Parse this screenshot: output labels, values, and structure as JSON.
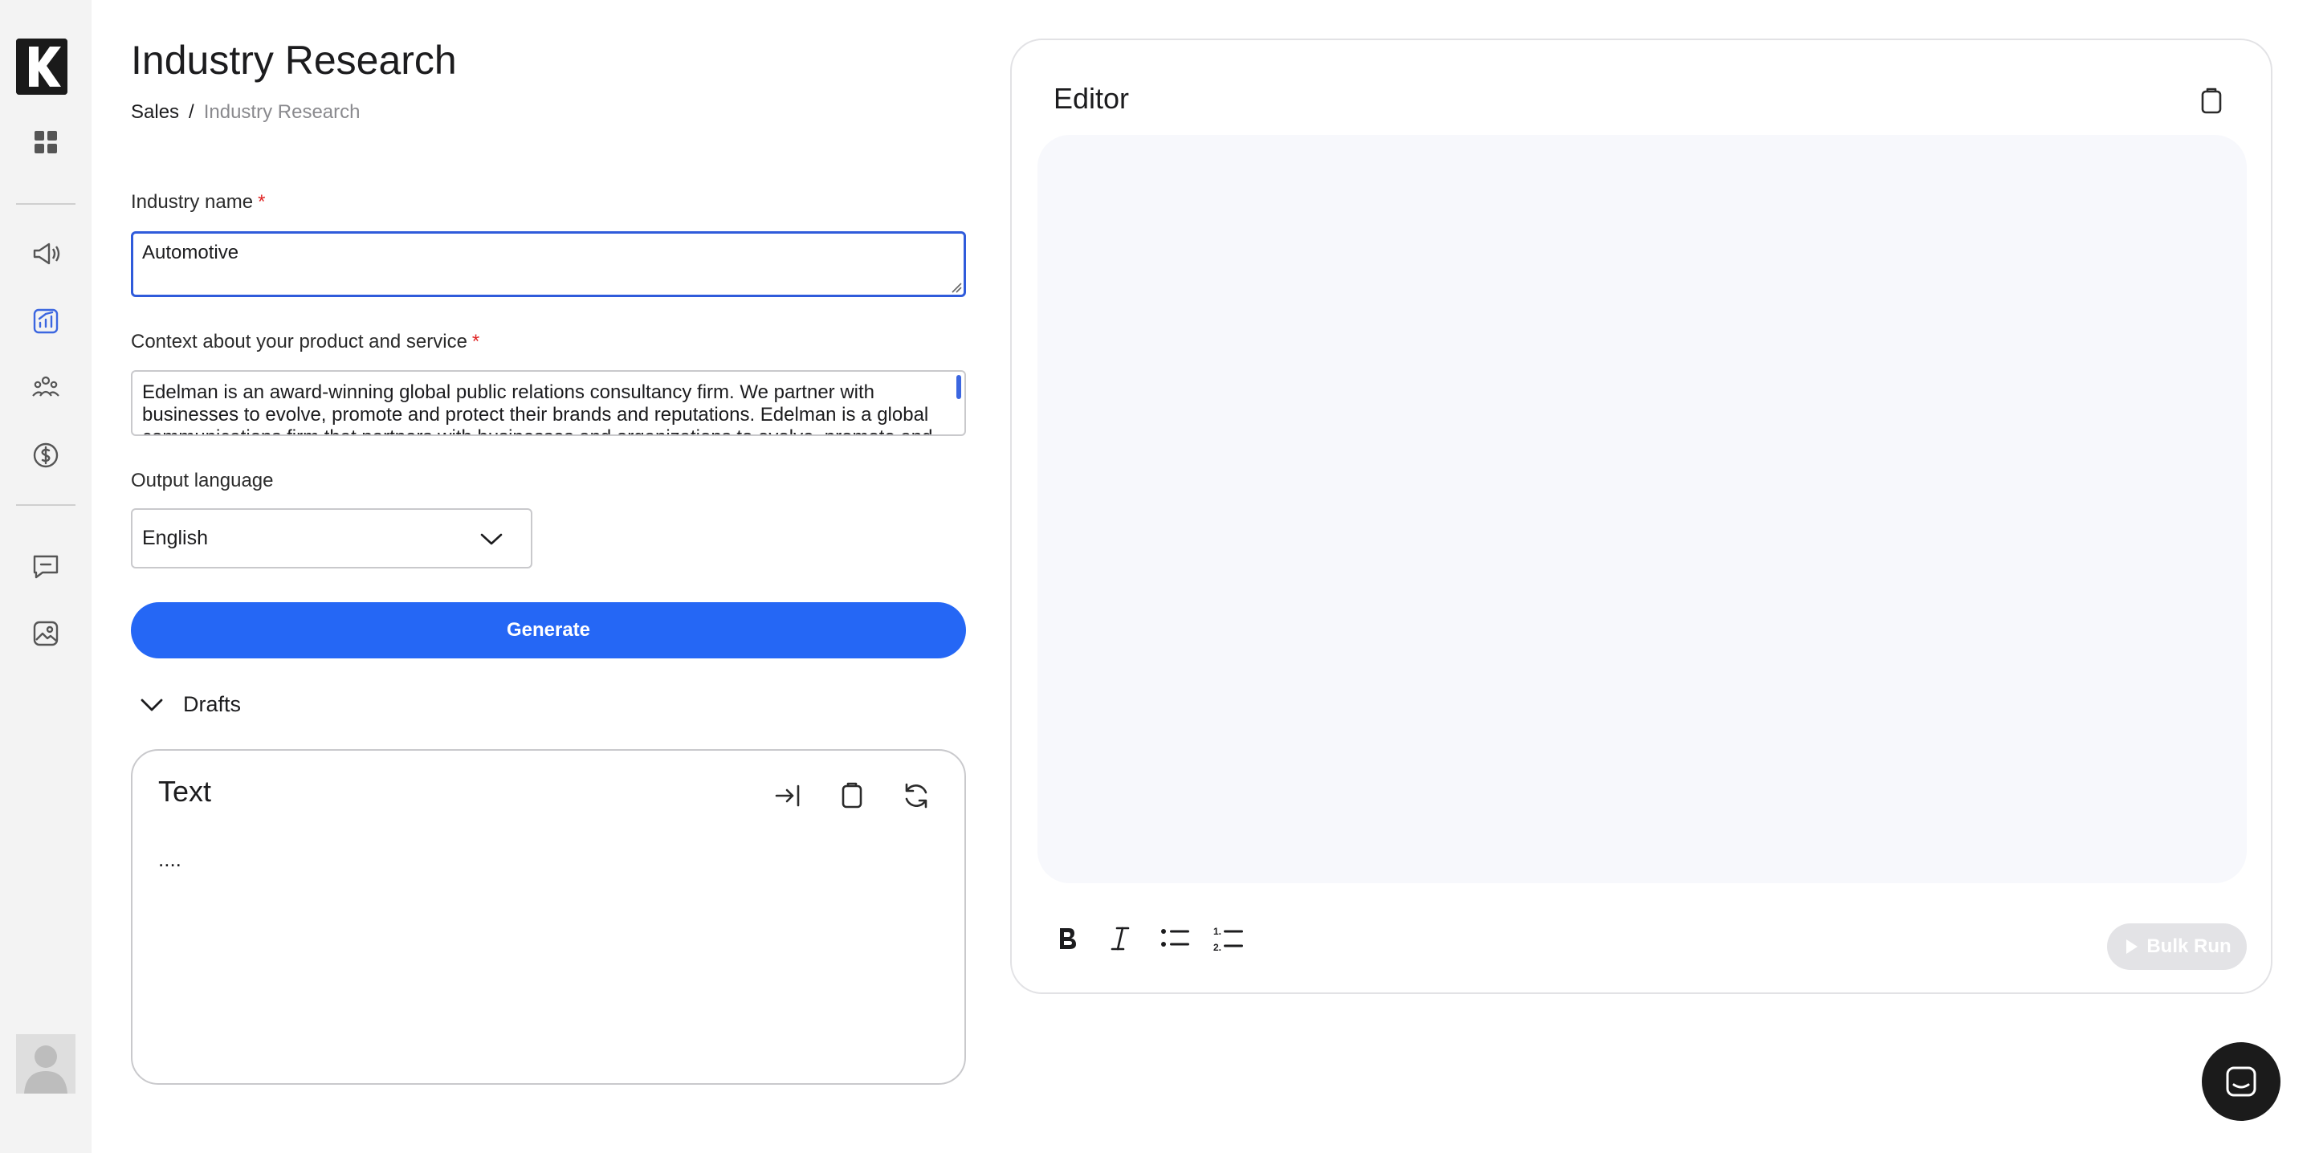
{
  "header": {
    "title": "Industry Research",
    "breadcrumb": {
      "parent": "Sales",
      "separator": "/",
      "current": "Industry Research"
    }
  },
  "form": {
    "industry": {
      "label": "Industry name",
      "required_mark": "*",
      "value": "Automotive"
    },
    "context": {
      "label": "Context about your product and service",
      "required_mark": "*",
      "value": "Edelman is an award-winning global public relations consultancy firm. We partner with businesses to evolve, promote and protect their brands and reputations. Edelman is a global communications firm that partners with businesses and organizations to evolve, promote and protect their brands and reputations."
    },
    "language": {
      "label": "Output language",
      "selected": "English"
    },
    "generate_label": "Generate"
  },
  "drafts": {
    "toggle_label": "Drafts",
    "card": {
      "title": "Text",
      "body": "...."
    }
  },
  "editor": {
    "title": "Editor",
    "bulk_run_label": "Bulk Run"
  },
  "icons": {
    "sidebar": [
      "dashboard-icon",
      "megaphone-icon",
      "analytics-icon",
      "team-icon",
      "dollar-icon",
      "chat-icon",
      "image-icon"
    ],
    "draft_actions": [
      "insert-icon",
      "copy-icon",
      "refresh-icon"
    ],
    "formatting": [
      "bold-icon",
      "italic-icon",
      "bullet-list-icon",
      "numbered-list-icon"
    ]
  },
  "colors": {
    "accent": "#2567f5",
    "active_nav": "#3b66e0",
    "required": "#e02424"
  }
}
